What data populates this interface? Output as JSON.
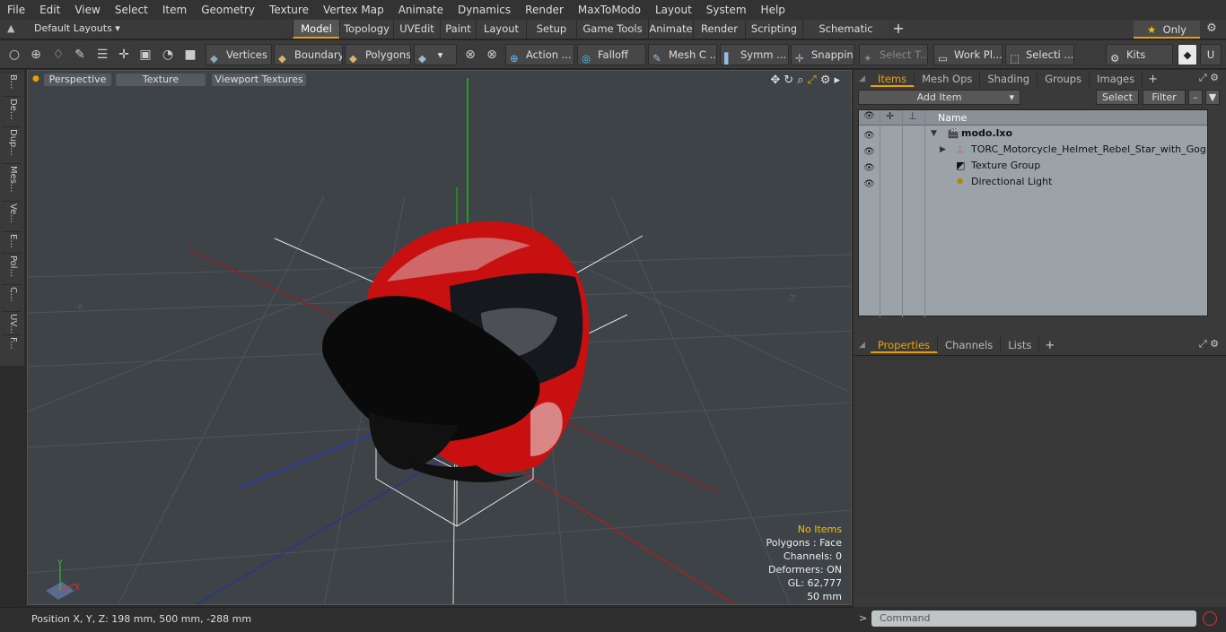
{
  "menu": [
    "File",
    "Edit",
    "View",
    "Select",
    "Item",
    "Geometry",
    "Texture",
    "Vertex Map",
    "Animate",
    "Dynamics",
    "Render",
    "MaxToModo",
    "Layout",
    "System",
    "Help"
  ],
  "layouts": {
    "dropdown": "Default Layouts ▾"
  },
  "tabs": [
    "Model",
    "Topology",
    "UVEdit",
    "Paint",
    "Layout",
    "Setup",
    "Game Tools",
    "Animate",
    "Render",
    "Scripting",
    "Schematic Fusion"
  ],
  "active_tab": "Model",
  "only_label": "Only",
  "toolbar": {
    "vertices": "Vertices",
    "boundary": "Boundary",
    "polygons": "Polygons",
    "action": "Action",
    "falloff": "Falloff",
    "mesh": "Mesh C ...",
    "symm": "Symm ...",
    "snapping": "Snapping",
    "select_t": "Select T...",
    "workpl": "Work Pl...",
    "selecti": "Selecti ...",
    "kits": "Kits"
  },
  "left_strip": [
    "B...",
    "De...",
    "Dup...",
    "Mes...",
    "Ve...",
    "E...",
    "Pol...",
    "C...",
    "UV...",
    "F..."
  ],
  "viewport": {
    "buttons": [
      "Perspective",
      "Texture",
      "Viewport Textures"
    ],
    "axis_labels": {
      "neg_x": "-X",
      "neg_z": "-Z",
      "y": "Y",
      "x": "X"
    },
    "stats": {
      "noitems": "No Items",
      "polygons": "Polygons : Face",
      "channels": "Channels: 0",
      "deformers": "Deformers: ON",
      "gl": "GL: 62,777",
      "size": "50 mm"
    },
    "colors": {
      "helmet_red": "#c81010",
      "helmet_black": "#0a0a0a",
      "grid": "#5a6064",
      "bg": "#3e4347"
    }
  },
  "status": {
    "position": "Position X, Y, Z:   198 mm, 500 mm, -288 mm"
  },
  "items_panel": {
    "tabs": [
      "Items",
      "Mesh Ops",
      "Shading",
      "Groups",
      "Images"
    ],
    "add_item": "Add Item",
    "select": "Select",
    "filter": "Filter",
    "col_name": "Name",
    "rows": [
      {
        "name": "modo.lxo"
      },
      {
        "name": "TORC_Motorcycle_Helmet_Rebel_Star_with_Goggle ..."
      },
      {
        "name": "Texture Group"
      },
      {
        "name": "Directional Light"
      }
    ]
  },
  "props_panel": {
    "tabs": [
      "Properties",
      "Channels",
      "Lists"
    ]
  },
  "command": {
    "placeholder": "Command"
  }
}
